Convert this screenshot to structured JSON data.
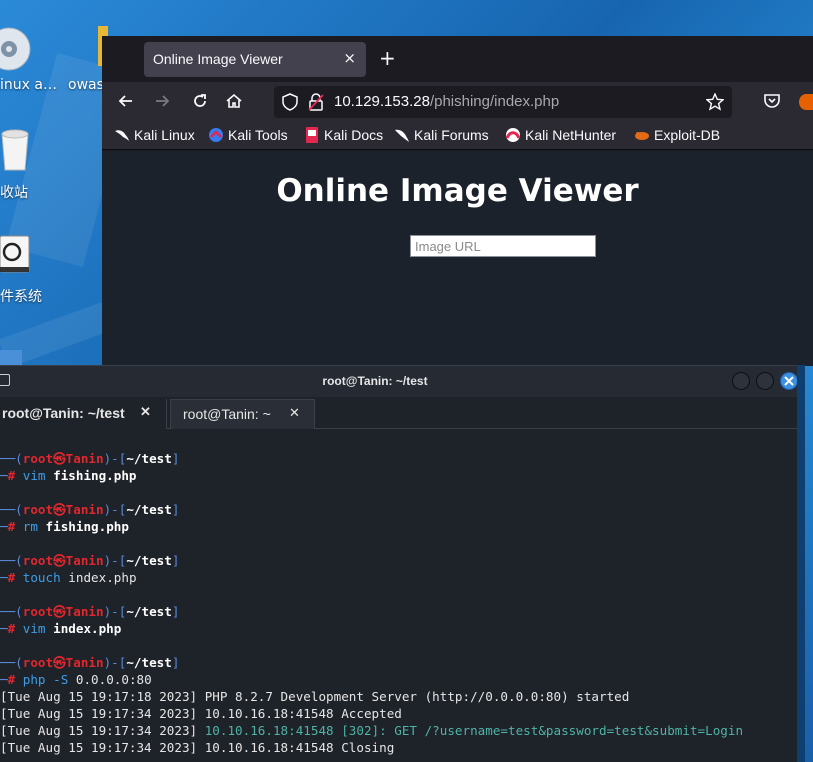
{
  "desktop": {
    "icons": [
      {
        "label": "inux a…",
        "icon": "disc-icon"
      },
      {
        "label": "owas",
        "icon": "folder-icon"
      },
      {
        "label": "收站",
        "icon": "trash-icon"
      },
      {
        "label": "件系统",
        "icon": "drive-icon"
      }
    ]
  },
  "browser": {
    "tab": {
      "title": "Online Image Viewer",
      "close": "×"
    },
    "new_tab": "+",
    "url": {
      "host": "10.129.153.28",
      "path": "/phishing/index.php"
    },
    "bookmarks": [
      {
        "label": "Kali Linux",
        "icon": "kali-dragon-icon"
      },
      {
        "label": "Kali Tools",
        "icon": "kali-tools-icon"
      },
      {
        "label": "Kali Docs",
        "icon": "kali-docs-icon"
      },
      {
        "label": "Kali Forums",
        "icon": "kali-forums-icon"
      },
      {
        "label": "Kali NetHunter",
        "icon": "nethunter-icon"
      },
      {
        "label": "Exploit-DB",
        "icon": "exploit-db-icon"
      }
    ],
    "page": {
      "title": "Online Image Viewer",
      "input_placeholder": "Image URL"
    }
  },
  "terminal": {
    "title": "root@Tanin: ~/test",
    "tabs": [
      {
        "label": "root@Tanin: ~/test",
        "close": "✕"
      },
      {
        "label": "root@Tanin: ~",
        "close": "✕"
      }
    ],
    "prompt": {
      "open": "──(",
      "user": "root",
      "at": "㉿",
      "host": "Tanin",
      "mid": ")-[",
      "dir": "~/test",
      "close": "]",
      "hash": "─# "
    },
    "commands": [
      {
        "cmd": "vim",
        "arg": "fishing.php"
      },
      {
        "cmd": "rm",
        "arg": "fishing.php"
      },
      {
        "cmd": "touch",
        "arg": "index.php"
      },
      {
        "cmd": "vim",
        "arg": "index.php"
      },
      {
        "cmd": "php",
        "arg": "-S 0.0.0.0:80"
      }
    ],
    "log": [
      {
        "prefix": "[Tue Aug 15 19:17:18 2023] ",
        "main": "PHP 8.2.7 Development Server (http://0.0.0.0:80) started",
        "hl": ""
      },
      {
        "prefix": "[Tue Aug 15 19:17:34 2023] ",
        "main": "10.10.16.18:41548 Accepted",
        "hl": ""
      },
      {
        "prefix": "[Tue Aug 15 19:17:34 2023] ",
        "main": "",
        "hl": "10.10.16.18:41548 [302]: GET /?username=test&password=test&submit=Login"
      },
      {
        "prefix": "[Tue Aug 15 19:17:34 2023] ",
        "main": "10.10.16.18:41548 Closing",
        "hl": ""
      }
    ]
  }
}
